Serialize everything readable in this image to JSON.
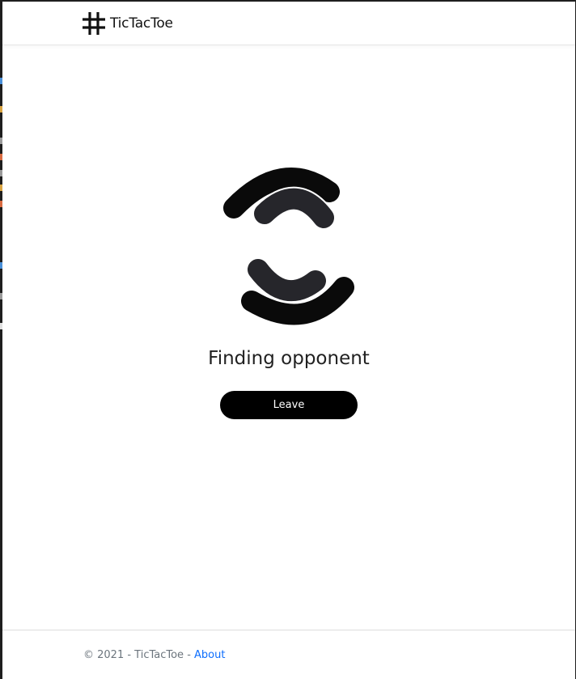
{
  "navbar": {
    "brand_icon": "hash-icon",
    "brand_label": "TicTacToe"
  },
  "main": {
    "spinner_icon": "loading-arcs-icon",
    "status_text": "Finding opponent",
    "leave_label": "Leave"
  },
  "footer": {
    "copyright": "© 2021 - TicTacToe - ",
    "about_label": "About"
  },
  "colors": {
    "button_bg": "#000000",
    "button_text": "#ffffff",
    "link": "#0d6efd",
    "footer_text": "#6c757d",
    "spinner_outer": "#0a0a0a",
    "spinner_inner": "#26262b"
  }
}
